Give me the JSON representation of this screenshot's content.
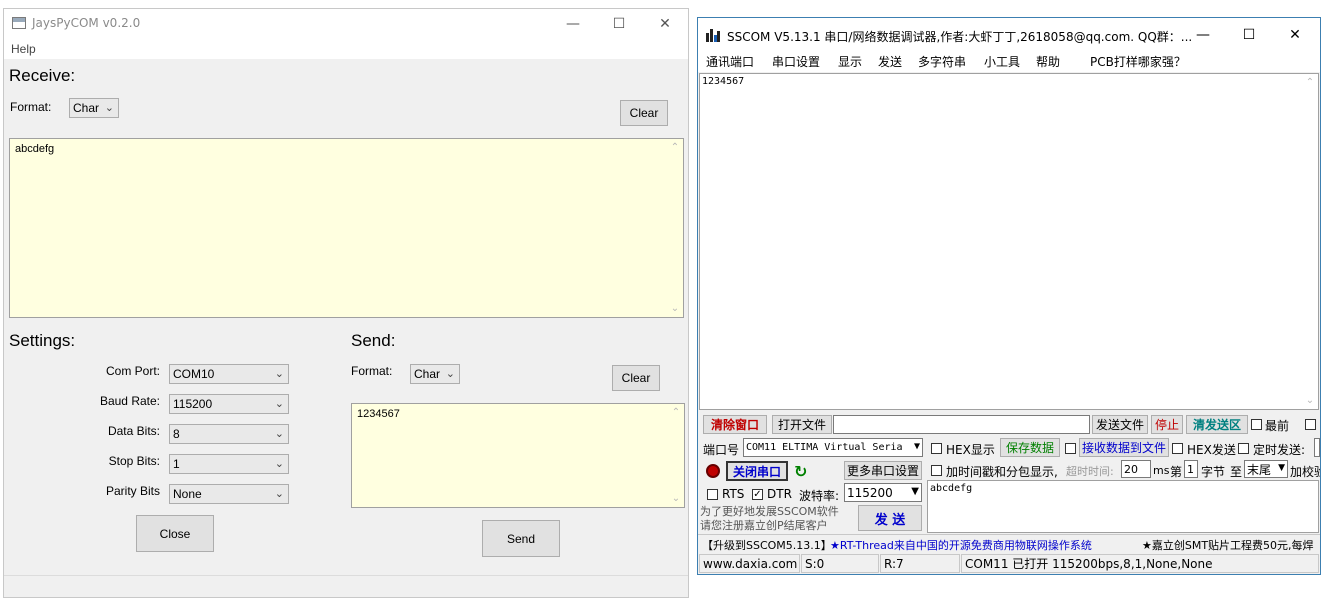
{
  "left_window": {
    "title": "JaysPyCOM v0.2.0",
    "menu": {
      "help": "Help"
    },
    "receive": {
      "heading": "Receive:",
      "format_label": "Format:",
      "format_value": "Char",
      "clear_label": "Clear",
      "text": "abcdefg"
    },
    "settings": {
      "heading": "Settings:",
      "fields": [
        {
          "label": "Com Port:",
          "value": "COM10"
        },
        {
          "label": "Baud Rate:",
          "value": "115200"
        },
        {
          "label": "Data Bits:",
          "value": "8"
        },
        {
          "label": "Stop Bits:",
          "value": "1"
        },
        {
          "label": "Parity Bits",
          "value": "None"
        }
      ],
      "close_label": "Close"
    },
    "send": {
      "heading": "Send:",
      "format_label": "Format:",
      "format_value": "Char",
      "clear_label": "Clear",
      "text": "1234567",
      "send_label": "Send"
    }
  },
  "right_window": {
    "title": "SSCOM V5.13.1 串口/网络数据调试器,作者:大虾丁丁,2618058@qq.com. QQ群：...",
    "menu": [
      "通讯端口",
      "串口设置",
      "显示",
      "发送",
      "多字符串",
      "小工具",
      "帮助",
      "PCB打样哪家强？"
    ],
    "receive_text": "1234567",
    "toolbar": {
      "clear_window": "清除窗口",
      "open_file": "打开文件",
      "send_file": "发送文件",
      "stop": "停止",
      "clear_send": "清发送区",
      "last": "最前"
    },
    "port_row": {
      "port_label": "端口号",
      "port_value": "COM11 ELTIMA Virtual Seria",
      "hex_display": "HEX显示",
      "save_data": "保存数据",
      "recv_to_file": "接收数据到文件",
      "hex_send": "HEX发送",
      "timed_send": "定时发送:"
    },
    "row2": {
      "close_port": "关闭串口",
      "more_settings": "更多串口设置",
      "timestamp": "加时间戳和分包显示,",
      "timeout_label": "超时时间:",
      "timeout_value": "20",
      "ms": "ms",
      "nth": "第",
      "byte_value": "1",
      "byte_label": "字节",
      "to": "至",
      "end_value": "末尾",
      "checksum": "加校验"
    },
    "row3": {
      "rts": "RTS",
      "dtr": "DTR",
      "baud_label": "波特率:",
      "baud_value": "115200"
    },
    "send_text": "abcdefg",
    "promo": {
      "line1": "为了更好地发展SSCOM软件",
      "line2": "请您注册嘉立创P结尾客户",
      "send_label": "发 送"
    },
    "ticker": {
      "upgrade": "【升级到SSCOM5.13.1】",
      "rt_thread": "★RT-Thread来自中国的开源免费商用物联网操作系统",
      "jlc": "★嘉立创SMT贴片工程费50元,每焊"
    },
    "status": {
      "site": "www.daxia.com",
      "sent": "S:0",
      "recv": "R:7",
      "port_status": "COM11 已打开  115200bps,8,1,None,None"
    }
  },
  "colors": {
    "receive_bg": "#ffffe0",
    "accent_red": "#c00000",
    "accent_green": "#008000",
    "link_blue": "#0000cc"
  }
}
